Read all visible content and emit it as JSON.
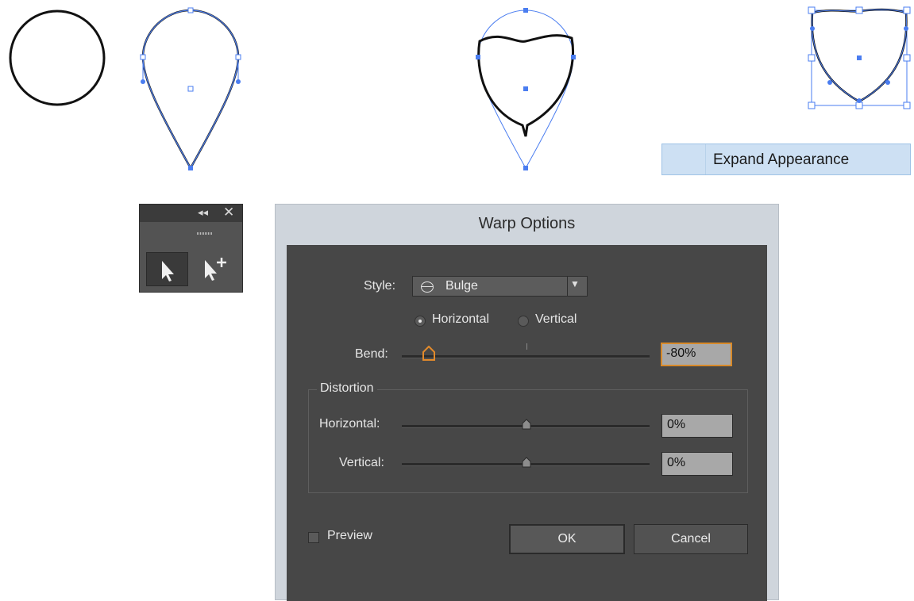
{
  "menu": {
    "expand_appearance": "Expand Appearance"
  },
  "tools_panel": {
    "collapse_glyph": "◂◂",
    "close_glyph": "✕",
    "tools": [
      "selection-tool",
      "direct-selection-add-tool"
    ]
  },
  "dialog": {
    "title": "Warp Options",
    "style_label": "Style:",
    "style_value": "Bulge",
    "orientation": {
      "horizontal": "Horizontal",
      "vertical": "Vertical",
      "selected": "Horizontal"
    },
    "bend": {
      "label": "Bend:",
      "value": "-80%",
      "level": -80
    },
    "distortion": {
      "legend": "Distortion",
      "horizontal": {
        "label": "Horizontal:",
        "value": "0%",
        "level": 0
      },
      "vertical": {
        "label": "Vertical:",
        "value": "0%",
        "level": 0
      }
    },
    "preview_label": "Preview",
    "preview_checked": false,
    "ok_label": "OK",
    "cancel_label": "Cancel"
  },
  "colors": {
    "selection_blue": "#4a7df0",
    "focus_orange": "#d88a2a"
  }
}
